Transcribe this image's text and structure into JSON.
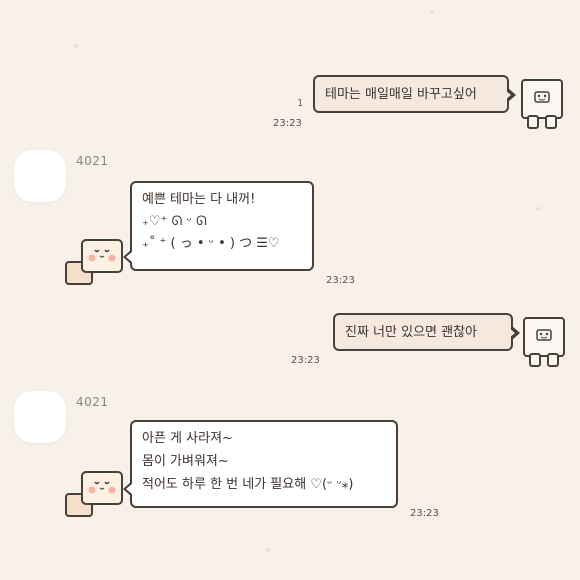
{
  "colors": {
    "background": "#f7f1ea",
    "my_bubble": "#f5e8df",
    "their_bubble": "#ffffff",
    "outline": "#4a403a"
  },
  "messages": [
    {
      "from": "me",
      "lines": [
        "테마는 매일매일 바꾸고싶어"
      ],
      "unread": "1",
      "time": "23:23"
    },
    {
      "from": "4021",
      "sender": "4021",
      "lines": [
        "예쁜 테마는 다 내꺼!",
        "₊♡⁺  ᘏ ᵕ ᘏ",
        "₊˚ ⁺ ( っ • ᵕ • ) ͏つ ☰♡"
      ],
      "time": "23:23"
    },
    {
      "from": "me",
      "lines": [
        "진짜 너만 있으면 괜찮아"
      ],
      "time": "23:23"
    },
    {
      "from": "4021",
      "sender": "4021",
      "lines": [
        "아픈 게 사라져~",
        "몸이 가벼워져~",
        "적어도 하루 한 번 네가 필요해 ♡(ᵕ ᵕ⁎)"
      ],
      "time": "23:23"
    }
  ],
  "icons": {
    "my_avatar": "square-bear-icon",
    "their_character": "cheek-blush-bear-icon"
  }
}
